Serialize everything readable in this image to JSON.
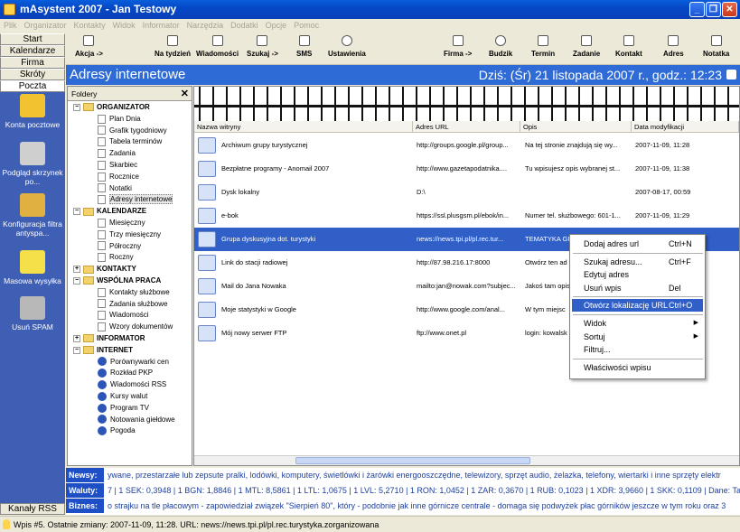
{
  "window": {
    "title": "mAsystent 2007 - Jan Testowy",
    "buttons": [
      "_",
      "❐",
      "✕"
    ]
  },
  "menu": [
    "Plik",
    "Organizator",
    "Kontakty",
    "Widok",
    "Informator",
    "Narzędzia",
    "Dodatki",
    "Opcje",
    "Pomoc"
  ],
  "nav": {
    "buttons": [
      "Start",
      "Kalendarze",
      "Firma",
      "Skróty",
      "Poczta"
    ],
    "active": "Poczta",
    "items": [
      {
        "label": "Konta pocztowe",
        "icon": "mail-accounts-icon"
      },
      {
        "label": "Podgląd skrzynek po...",
        "icon": "mailbox-preview-icon"
      },
      {
        "label": "Konfiguracja filtra antyspa...",
        "icon": "antispam-config-icon"
      },
      {
        "label": "Masowa wysyłka",
        "icon": "mass-mailing-icon"
      },
      {
        "label": "Usuń SPAM",
        "icon": "delete-spam-icon"
      }
    ],
    "bottom": "Kanały RSS"
  },
  "toolbar": {
    "left": [
      "Akcja ->",
      "Na tydzień",
      "Wiadomości",
      "Szukaj ->",
      "SMS",
      "Ustawienia"
    ],
    "right": [
      "Firma ->",
      "Budzik",
      "Termin",
      "Zadanie",
      "Kontakt",
      "Adres",
      "Notatka"
    ]
  },
  "header": {
    "title": "Adresy internetowe",
    "date": "Dziś: (Śr) 21 listopada 2007 r., godz.: 12:23"
  },
  "folders": {
    "title": "Foldery",
    "close": "✕",
    "groups": [
      {
        "name": "ORGANIZATOR",
        "expander": "−",
        "items": [
          "Plan Dnia",
          "Grafik tygodniowy",
          "Tabela terminów",
          "Zadania",
          "Skarbiec",
          "Rocznice",
          "Notatki",
          "Adresy internetowe"
        ]
      },
      {
        "name": "KALENDARZE",
        "expander": "−",
        "items": [
          "Miesięczny",
          "Trzy miesięczny",
          "Półroczny",
          "Roczny"
        ]
      },
      {
        "name": "KONTAKTY",
        "expander": "+",
        "items": []
      },
      {
        "name": "WSPÓLNA PRACA",
        "expander": "−",
        "items": [
          "Kontakty służbowe",
          "Zadania służbowe",
          "Wiadomości",
          "Wzory dokumentów"
        ]
      },
      {
        "name": "INFORMATOR",
        "expander": "+",
        "items": []
      },
      {
        "name": "INTERNET",
        "expander": "−",
        "items": [
          "Porównywarki cen",
          "Rozkład PKP",
          "Wiadomości RSS",
          "Kursy walut",
          "Program TV",
          "Notowania giełdowe",
          "Pogoda"
        ]
      }
    ],
    "selected": "Adresy internetowe"
  },
  "table": {
    "columns": [
      "Nazwa witryny",
      "Adres URL",
      "Opis",
      "Data modyfikacji"
    ],
    "rows": [
      [
        "Archiwum grupy turystycznej",
        "http://groups.google.pl/group...",
        "Na tej stronie znajdują się wy...",
        "2007-11-09, 11:28"
      ],
      [
        "Bezpłatne programy - Anomail 2007",
        "http://www.gazetapodatnika....",
        "Tu wpisujesz opis wybranej st...",
        "2007-11-09, 11:38"
      ],
      [
        "Dysk lokalny",
        "D:\\",
        "",
        "2007-08-17, 00:59"
      ],
      [
        "e-bok",
        "https://ssl.plusgsm.pl/ebok/in...",
        "Numer tel. służbowego: 601-1...",
        "2007-11-09, 11:29"
      ],
      [
        "Grupa dyskusyjna dot. turystyki",
        "news://news.tpi.pl/pl.rec.tur...",
        "TEMATYKA GRU",
        ""
      ],
      [
        "Link do stacji radiowej",
        "http://87.98.216.17:8000",
        "Otwórz ten ad",
        ""
      ],
      [
        "Mail do Jana Nowaka",
        "mailto:jan@nowak.com?subjec...",
        "Jakoś tam opis",
        ""
      ],
      [
        "Moje statystyki w Google",
        "http://www.google.com/anal...",
        "W tym miejsc",
        ""
      ],
      [
        "Mój nowy serwer FTP",
        "ftp://www.onet.pl",
        "login: kowalsk",
        ""
      ]
    ],
    "selected_row": 4
  },
  "context_menu": [
    {
      "label": "Dodaj adres url",
      "shortcut": "Ctrl+N"
    },
    {
      "sep": true
    },
    {
      "label": "Szukaj adresu...",
      "shortcut": "Ctrl+F"
    },
    {
      "label": "Edytuj adres",
      "shortcut": ""
    },
    {
      "label": "Usuń wpis",
      "shortcut": "Del"
    },
    {
      "sep": true
    },
    {
      "label": "Otwórz lokalizację URL",
      "shortcut": "Ctrl+O",
      "highlighted": true
    },
    {
      "sep": true
    },
    {
      "label": "Widok",
      "submenu": true
    },
    {
      "label": "Sortuj",
      "submenu": true
    },
    {
      "label": "Filtruj...",
      "shortcut": ""
    },
    {
      "sep": true
    },
    {
      "label": "Właściwości wpisu",
      "shortcut": ""
    }
  ],
  "ticker": [
    {
      "label": "Newsy:",
      "text": "ywane, przestarzałe lub zepsute pralki, lodówki, komputery, świetlówki i żarówki energooszczędne, telewizory, sprzęt audio, żelazka, telefony, wiertarki i inne sprzęty elektr"
    },
    {
      "label": "Waluty:",
      "text": "7 | 1 SEK: 0,3948 | 1 BGN: 1,8846 | 1 MTL: 8,5861 | 1 LTL: 1,0675 | 1 LVL: 5,2710 | 1 RON: 1,0452 | 1 ZAR: 0,3670 | 1 RUB: 0,1023 | 1 XDR: 3,9660 | 1 SKK: 0,1109 | Dane: Tab"
    },
    {
      "label": "Biznes:",
      "text": "o strajku na tle płacowym - zapowiedział związek \"Sierpień 80\", który - podobnie jak inne górnicze centrale - domaga się podwyżek płac górników jeszcze w tym roku oraz 3"
    }
  ],
  "status": "Wpis #5. Ostatnie zmiany: 2007-11-09, 11:28. URL: news://news.tpi.pl/pl.rec.turystyka.zorganizowana",
  "colors": {
    "titlebar": "#0A5EDB",
    "header": "#2F6BD6",
    "selection": "#2F5FC7",
    "nav": "#3F5FB5"
  }
}
